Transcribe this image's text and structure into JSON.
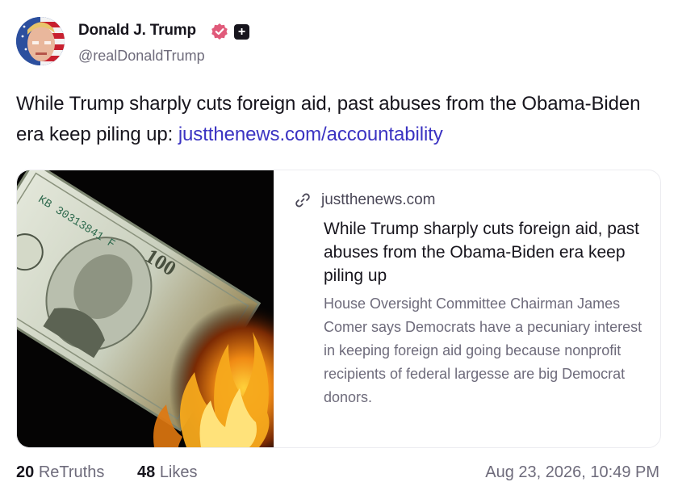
{
  "author": {
    "name": "Donald J. Trump",
    "handle": "@realDonaldTrump",
    "verified_icon": "verified-badge-icon",
    "follow_icon": "plus-icon",
    "follow_symbol": "+"
  },
  "post": {
    "text": "While Trump sharply cuts foreign aid, past abuses from the Obama-Biden era keep piling up: ",
    "link_text": "justthenews.com/accountability"
  },
  "link_card": {
    "image": "burning-dollar-bill-image",
    "link_icon": "link-icon",
    "domain": "justthenews.com",
    "title": "While Trump sharply cuts foreign aid, past abuses from the Obama-Biden era keep piling up",
    "description": "House Oversight Committee Chairman James Comer says Democrats have a pecuniary interest in keeping foreign aid going because nonprofit recipients of federal largesse are big Democrat donors."
  },
  "stats": {
    "retruths_count": "20",
    "retruths_label": "ReTruths",
    "likes_count": "48",
    "likes_label": "Likes"
  },
  "timestamp": "Aug 23, 2026, 10:49 PM",
  "colors": {
    "link": "#3b33c2",
    "verified_badge": "#e05a7a",
    "text_primary": "#17151d",
    "text_secondary": "#6e6b7b"
  }
}
